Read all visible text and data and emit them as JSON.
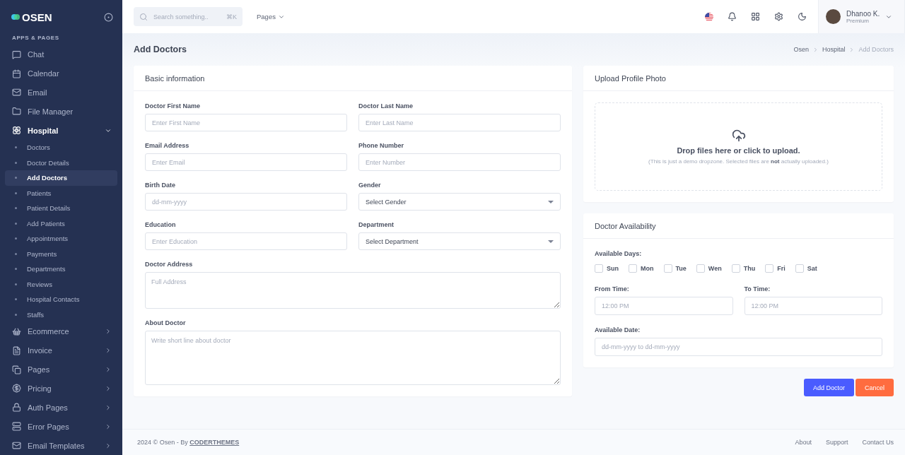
{
  "brand": {
    "name": "OSEN"
  },
  "sidebar": {
    "section_title": "APPS & PAGES",
    "items": [
      {
        "label": "Chat",
        "kind": "link",
        "selected": false
      },
      {
        "label": "Calendar",
        "kind": "link",
        "selected": false
      },
      {
        "label": "Email",
        "kind": "link",
        "selected": false
      },
      {
        "label": "File Manager",
        "kind": "link",
        "selected": false
      },
      {
        "label": "Hospital",
        "kind": "group",
        "selected": true,
        "expanded": true,
        "children": [
          {
            "label": "Doctors",
            "selected": false
          },
          {
            "label": "Doctor Details",
            "selected": false
          },
          {
            "label": "Add Doctors",
            "selected": true
          },
          {
            "label": "Patients",
            "selected": false
          },
          {
            "label": "Patient Details",
            "selected": false
          },
          {
            "label": "Add Patients",
            "selected": false
          },
          {
            "label": "Appointments",
            "selected": false
          },
          {
            "label": "Payments",
            "selected": false
          },
          {
            "label": "Departments",
            "selected": false
          },
          {
            "label": "Reviews",
            "selected": false
          },
          {
            "label": "Hospital Contacts",
            "selected": false
          },
          {
            "label": "Staffs",
            "selected": false
          }
        ]
      },
      {
        "label": "Ecommerce",
        "kind": "group",
        "selected": false,
        "expanded": false
      },
      {
        "label": "Invoice",
        "kind": "group",
        "selected": false,
        "expanded": false
      },
      {
        "label": "Pages",
        "kind": "group",
        "selected": false,
        "expanded": false
      },
      {
        "label": "Pricing",
        "kind": "group",
        "selected": false,
        "expanded": false
      },
      {
        "label": "Auth Pages",
        "kind": "group",
        "selected": false,
        "expanded": false
      },
      {
        "label": "Error Pages",
        "kind": "group",
        "selected": false,
        "expanded": false
      },
      {
        "label": "Email Templates",
        "kind": "group",
        "selected": false,
        "expanded": false
      }
    ]
  },
  "topbar": {
    "search": {
      "placeholder": "Search something..",
      "shortcut": "⌘K"
    },
    "menu": "Pages",
    "user": {
      "name": "Dhanoo K.",
      "role": "Premium"
    }
  },
  "page": {
    "title": "Add Doctors",
    "breadcrumb": [
      "Osen",
      "Hospital",
      "Add Doctors"
    ]
  },
  "basic_information": {
    "title": "Basic information",
    "fields": [
      {
        "label": "Doctor First Name",
        "kind": "input",
        "placeholder": "Enter First Name"
      },
      {
        "label": "Doctor Last Name",
        "kind": "input",
        "placeholder": "Enter Last Name"
      },
      {
        "label": "Email Address",
        "kind": "input",
        "placeholder": "Enter Email"
      },
      {
        "label": "Phone Number",
        "kind": "input",
        "placeholder": "Enter Number"
      },
      {
        "label": "Birth Date",
        "kind": "input",
        "placeholder": "dd-mm-yyyy"
      },
      {
        "label": "Gender",
        "kind": "select",
        "value": "Select Gender"
      },
      {
        "label": "Education",
        "kind": "input",
        "placeholder": "Enter Education"
      },
      {
        "label": "Department",
        "kind": "select",
        "value": "Select Department"
      },
      {
        "label": "Doctor Address",
        "kind": "textarea",
        "placeholder": "Full Address"
      },
      {
        "label": "About Doctor",
        "kind": "textarea",
        "placeholder": "Write short line about doctor"
      }
    ]
  },
  "upload": {
    "title": "Upload Profile Photo",
    "heading": "Drop files here or click to upload.",
    "note": "(This is just a demo dropzone. Selected files are **not** actually uploaded.)"
  },
  "availability": {
    "title": "Doctor Availability",
    "days_label": "Available Days:",
    "days": [
      {
        "label": "Sun",
        "checked": false
      },
      {
        "label": "Mon",
        "checked": false
      },
      {
        "label": "Tue",
        "checked": false
      },
      {
        "label": "Wen",
        "checked": false
      },
      {
        "label": "Thu",
        "checked": false
      },
      {
        "label": "Fri",
        "checked": false
      },
      {
        "label": "Sat",
        "checked": false
      }
    ],
    "times": [
      {
        "label": "From Time:",
        "placeholder": "12:00 PM"
      },
      {
        "label": "To Time:",
        "placeholder": "12:00 PM"
      }
    ],
    "date": {
      "label": "Available Date:",
      "placeholder": "dd-mm-yyyy to dd-mm-yyyy"
    }
  },
  "actions": [
    {
      "label": "Add Doctor",
      "kind": "primary"
    },
    {
      "label": "Cancel",
      "kind": "cancel"
    }
  ],
  "footer": {
    "copyright": "2024 © Osen - By",
    "author": "CODERTHEMES",
    "links": [
      "About",
      "Support",
      "Contact Us"
    ]
  }
}
